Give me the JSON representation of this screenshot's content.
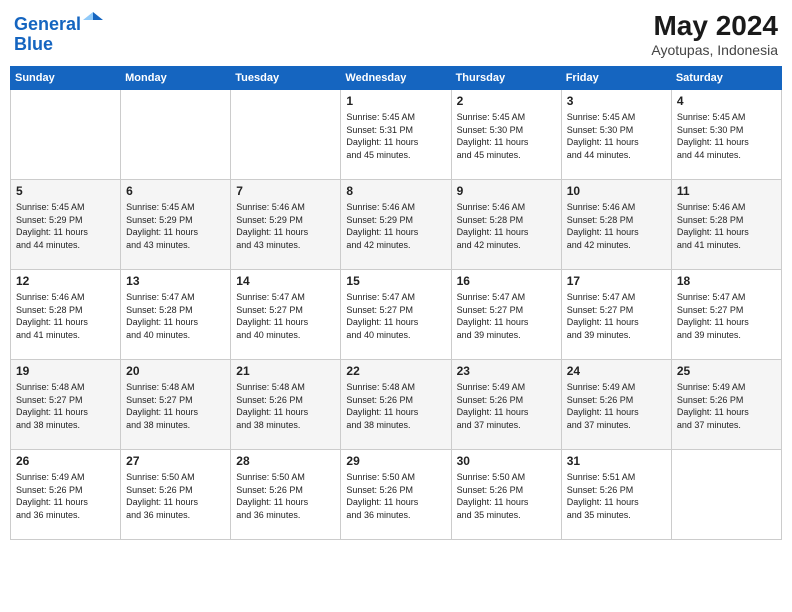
{
  "header": {
    "logo_line1": "General",
    "logo_line2": "Blue",
    "month_year": "May 2024",
    "location": "Ayotupas, Indonesia"
  },
  "columns": [
    "Sunday",
    "Monday",
    "Tuesday",
    "Wednesday",
    "Thursday",
    "Friday",
    "Saturday"
  ],
  "weeks": [
    [
      {
        "day": "",
        "info": ""
      },
      {
        "day": "",
        "info": ""
      },
      {
        "day": "",
        "info": ""
      },
      {
        "day": "1",
        "info": "Sunrise: 5:45 AM\nSunset: 5:31 PM\nDaylight: 11 hours\nand 45 minutes."
      },
      {
        "day": "2",
        "info": "Sunrise: 5:45 AM\nSunset: 5:30 PM\nDaylight: 11 hours\nand 45 minutes."
      },
      {
        "day": "3",
        "info": "Sunrise: 5:45 AM\nSunset: 5:30 PM\nDaylight: 11 hours\nand 44 minutes."
      },
      {
        "day": "4",
        "info": "Sunrise: 5:45 AM\nSunset: 5:30 PM\nDaylight: 11 hours\nand 44 minutes."
      }
    ],
    [
      {
        "day": "5",
        "info": "Sunrise: 5:45 AM\nSunset: 5:29 PM\nDaylight: 11 hours\nand 44 minutes."
      },
      {
        "day": "6",
        "info": "Sunrise: 5:45 AM\nSunset: 5:29 PM\nDaylight: 11 hours\nand 43 minutes."
      },
      {
        "day": "7",
        "info": "Sunrise: 5:46 AM\nSunset: 5:29 PM\nDaylight: 11 hours\nand 43 minutes."
      },
      {
        "day": "8",
        "info": "Sunrise: 5:46 AM\nSunset: 5:29 PM\nDaylight: 11 hours\nand 42 minutes."
      },
      {
        "day": "9",
        "info": "Sunrise: 5:46 AM\nSunset: 5:28 PM\nDaylight: 11 hours\nand 42 minutes."
      },
      {
        "day": "10",
        "info": "Sunrise: 5:46 AM\nSunset: 5:28 PM\nDaylight: 11 hours\nand 42 minutes."
      },
      {
        "day": "11",
        "info": "Sunrise: 5:46 AM\nSunset: 5:28 PM\nDaylight: 11 hours\nand 41 minutes."
      }
    ],
    [
      {
        "day": "12",
        "info": "Sunrise: 5:46 AM\nSunset: 5:28 PM\nDaylight: 11 hours\nand 41 minutes."
      },
      {
        "day": "13",
        "info": "Sunrise: 5:47 AM\nSunset: 5:28 PM\nDaylight: 11 hours\nand 40 minutes."
      },
      {
        "day": "14",
        "info": "Sunrise: 5:47 AM\nSunset: 5:27 PM\nDaylight: 11 hours\nand 40 minutes."
      },
      {
        "day": "15",
        "info": "Sunrise: 5:47 AM\nSunset: 5:27 PM\nDaylight: 11 hours\nand 40 minutes."
      },
      {
        "day": "16",
        "info": "Sunrise: 5:47 AM\nSunset: 5:27 PM\nDaylight: 11 hours\nand 39 minutes."
      },
      {
        "day": "17",
        "info": "Sunrise: 5:47 AM\nSunset: 5:27 PM\nDaylight: 11 hours\nand 39 minutes."
      },
      {
        "day": "18",
        "info": "Sunrise: 5:47 AM\nSunset: 5:27 PM\nDaylight: 11 hours\nand 39 minutes."
      }
    ],
    [
      {
        "day": "19",
        "info": "Sunrise: 5:48 AM\nSunset: 5:27 PM\nDaylight: 11 hours\nand 38 minutes."
      },
      {
        "day": "20",
        "info": "Sunrise: 5:48 AM\nSunset: 5:27 PM\nDaylight: 11 hours\nand 38 minutes."
      },
      {
        "day": "21",
        "info": "Sunrise: 5:48 AM\nSunset: 5:26 PM\nDaylight: 11 hours\nand 38 minutes."
      },
      {
        "day": "22",
        "info": "Sunrise: 5:48 AM\nSunset: 5:26 PM\nDaylight: 11 hours\nand 38 minutes."
      },
      {
        "day": "23",
        "info": "Sunrise: 5:49 AM\nSunset: 5:26 PM\nDaylight: 11 hours\nand 37 minutes."
      },
      {
        "day": "24",
        "info": "Sunrise: 5:49 AM\nSunset: 5:26 PM\nDaylight: 11 hours\nand 37 minutes."
      },
      {
        "day": "25",
        "info": "Sunrise: 5:49 AM\nSunset: 5:26 PM\nDaylight: 11 hours\nand 37 minutes."
      }
    ],
    [
      {
        "day": "26",
        "info": "Sunrise: 5:49 AM\nSunset: 5:26 PM\nDaylight: 11 hours\nand 36 minutes."
      },
      {
        "day": "27",
        "info": "Sunrise: 5:50 AM\nSunset: 5:26 PM\nDaylight: 11 hours\nand 36 minutes."
      },
      {
        "day": "28",
        "info": "Sunrise: 5:50 AM\nSunset: 5:26 PM\nDaylight: 11 hours\nand 36 minutes."
      },
      {
        "day": "29",
        "info": "Sunrise: 5:50 AM\nSunset: 5:26 PM\nDaylight: 11 hours\nand 36 minutes."
      },
      {
        "day": "30",
        "info": "Sunrise: 5:50 AM\nSunset: 5:26 PM\nDaylight: 11 hours\nand 35 minutes."
      },
      {
        "day": "31",
        "info": "Sunrise: 5:51 AM\nSunset: 5:26 PM\nDaylight: 11 hours\nand 35 minutes."
      },
      {
        "day": "",
        "info": ""
      }
    ]
  ]
}
